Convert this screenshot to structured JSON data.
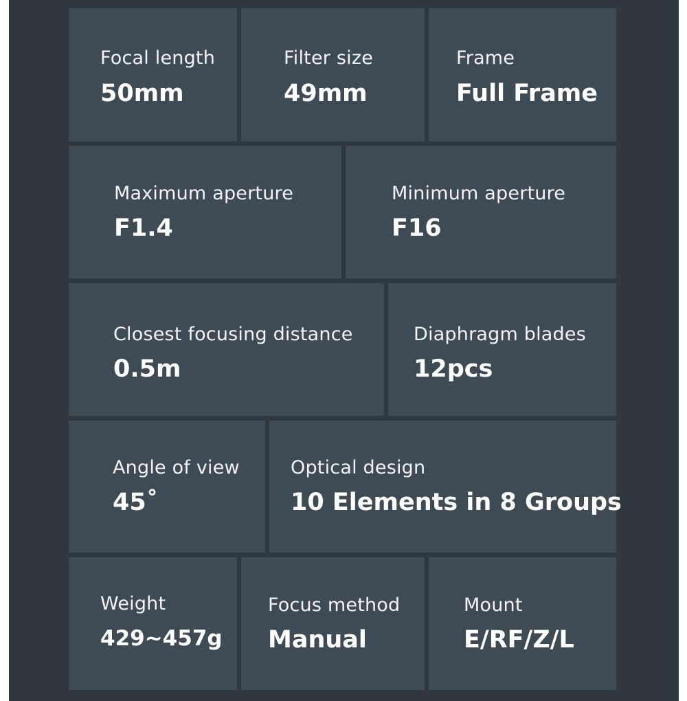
{
  "specs": {
    "focal_length": {
      "label": "Focal length",
      "value": "50mm"
    },
    "filter_size": {
      "label": "Filter size",
      "value": "49mm"
    },
    "frame": {
      "label": "Frame",
      "value": "Full Frame"
    },
    "max_aperture": {
      "label": "Maximum aperture",
      "value": "F1.4"
    },
    "min_aperture": {
      "label": "Minimum aperture",
      "value": "F16"
    },
    "closest_focus": {
      "label": "Closest focusing distance",
      "value": "0.5m"
    },
    "blades": {
      "label": "Diaphragm blades",
      "value": "12pcs"
    },
    "angle_of_view": {
      "label": "Angle of view",
      "value": "45˚"
    },
    "optical_design": {
      "label": "Optical design",
      "value": "10 Elements in 8 Groups"
    },
    "weight": {
      "label": "Weight",
      "value": "429~457g"
    },
    "focus_method": {
      "label": "Focus method",
      "value": "Manual"
    },
    "mount": {
      "label": "Mount",
      "value": "E/RF/Z/L"
    }
  },
  "colors": {
    "background": "#2f373f",
    "tile": "#3f4b54",
    "text": "#ffffff"
  }
}
